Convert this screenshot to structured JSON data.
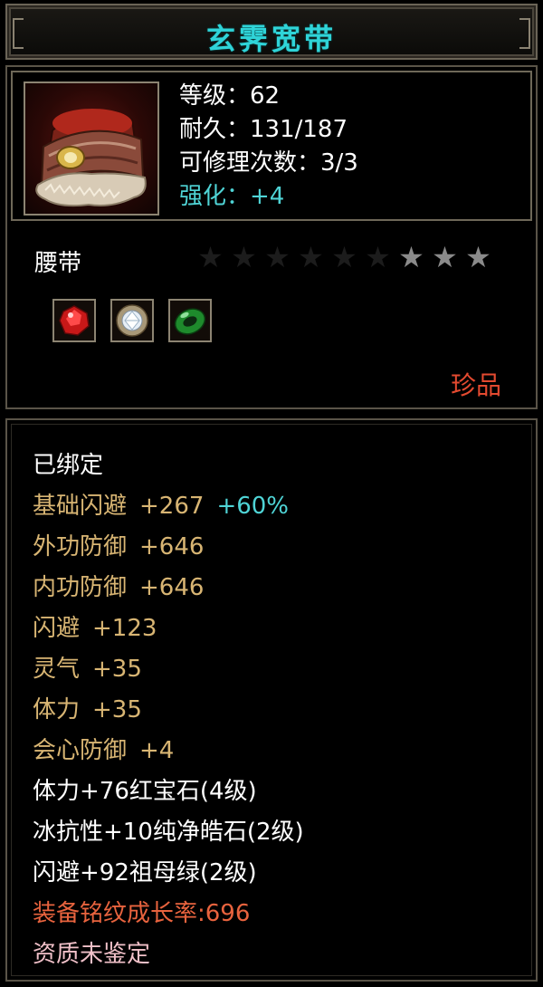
{
  "item": {
    "name": "玄霁宽带",
    "title_color": "#2fd4d8",
    "icon": "fur-belt-icon",
    "stats": {
      "level": "等级：62",
      "durability": "耐久：131/187",
      "repairs": "可修理次数：3/3",
      "enhance": "强化：+4"
    },
    "type": "腰带",
    "stars": {
      "total": 9,
      "lit": 3,
      "lit_positions": "last three",
      "lit_color": "#8a8a8a",
      "unlit_color": "#1c1c1c"
    },
    "gems": [
      {
        "name": "ruby-gem-icon"
      },
      {
        "name": "diamond-gem-icon"
      },
      {
        "name": "jade-gem-icon"
      }
    ],
    "rarity": "珍品",
    "rarity_color": "#e44a30"
  },
  "attributes": {
    "bound": "已绑定",
    "base_dodge": {
      "label": "基础闪避",
      "value": "+267",
      "bonus": "+60%"
    },
    "outer_def": {
      "label": "外功防御",
      "value": "+646"
    },
    "inner_def": {
      "label": "内功防御",
      "value": "+646"
    },
    "dodge": {
      "label": "闪避",
      "value": "+123"
    },
    "spirit": {
      "label": "灵气",
      "value": "+35"
    },
    "stamina": {
      "label": "体力",
      "value": "+35"
    },
    "crit_def": {
      "label": "会心防御",
      "value": "+4"
    },
    "gem1": "体力+76红宝石(4级)",
    "gem2": "冰抗性+10纯净皓石(2级)",
    "gem3": "闪避+92祖母绿(2级)",
    "growth": "装备铭纹成长率:696",
    "quality": "资质未鉴定"
  },
  "colors": {
    "white": "#ffffff",
    "gold": "#d8b573",
    "cyan": "#4fd4d6",
    "orange": "#e8633e",
    "pink": "#f0c0c8"
  }
}
